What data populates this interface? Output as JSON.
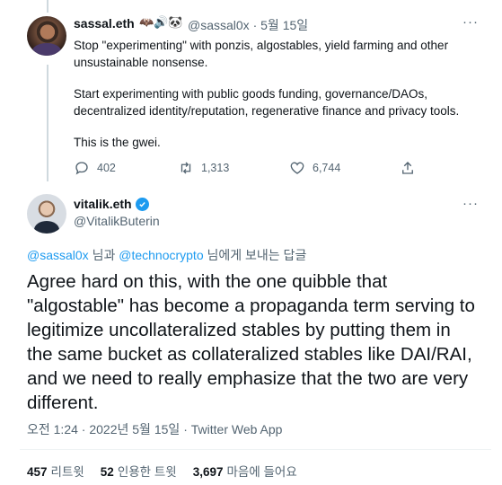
{
  "tweet1": {
    "name": "sassal.eth",
    "emojis": "🦇🔊🐼",
    "handle": "@sassal0x",
    "sep": "·",
    "date": "5월 15일",
    "line1": "Stop \"experimenting\" with ponzis, algostables, yield farming and other",
    "line2": "unsustainable nonsense.",
    "line3": "Start experimenting with public goods funding, governance/DAOs,",
    "line4": "decentralized identity/reputation, regenerative finance and privacy tools.",
    "line5": "This is the gwei.",
    "replies": "402",
    "retweets": "1,313",
    "likes": "6,744"
  },
  "tweet2": {
    "name": "vitalik.eth",
    "handle": "@VitalikButerin",
    "reply_to_user1": "@sassal0x",
    "reply_mid": " 님과 ",
    "reply_to_user2": "@technocrypto",
    "reply_end": " 님에게 보내는 답글",
    "line1": "Agree hard on this, with the one quibble that",
    "line2": "\"algostable\" has become a propaganda term serving to",
    "line3": "legitimize uncollateralized stables by putting them in",
    "line4": "the same bucket as collateralized stables like DAI/RAI,",
    "line5": "and we need to really emphasize that the two are very",
    "line6": "different.",
    "time": "오전 1:24",
    "sep": "·",
    "date": "2022년 5월 15일",
    "sep2": "·",
    "client": "Twitter Web App",
    "retweet_count": "457",
    "retweet_label": "리트윗",
    "quote_count": "52",
    "quote_label": "인용한 트윗",
    "like_count": "3,697",
    "like_label": "마음에 들어요"
  },
  "more_label": "···",
  "colors": {
    "accent": "#1d9bf0",
    "muted": "#536471",
    "text": "#0f1419"
  }
}
